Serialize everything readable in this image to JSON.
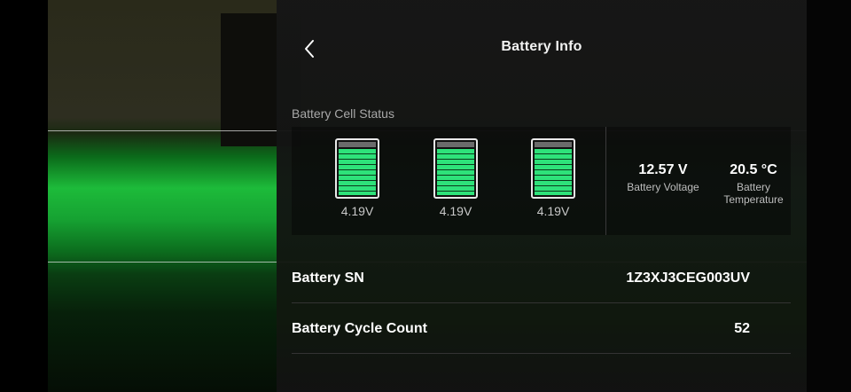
{
  "header": {
    "title": "Battery Info"
  },
  "cell_status": {
    "label": "Battery Cell Status",
    "cells": [
      {
        "voltage": "4.19V",
        "level": 1.0
      },
      {
        "voltage": "4.19V",
        "level": 1.0
      },
      {
        "voltage": "4.19V",
        "level": 1.0
      }
    ],
    "battery_voltage": {
      "value": "12.57 V",
      "label": "Battery Voltage"
    },
    "battery_temperature": {
      "value": "20.5 °C",
      "label_line1": "Battery",
      "label_line2": "Temperature"
    }
  },
  "info_rows": [
    {
      "label": "Battery SN",
      "value": "1Z3XJ3CEG003UV"
    },
    {
      "label": "Battery Cycle Count",
      "value": "52"
    }
  ],
  "colors": {
    "cell_fill": "#2ee27a",
    "panel_bg": "#161616",
    "camera_green": "#1dbb3a"
  },
  "icons": {
    "back": "chevron-left-icon"
  }
}
